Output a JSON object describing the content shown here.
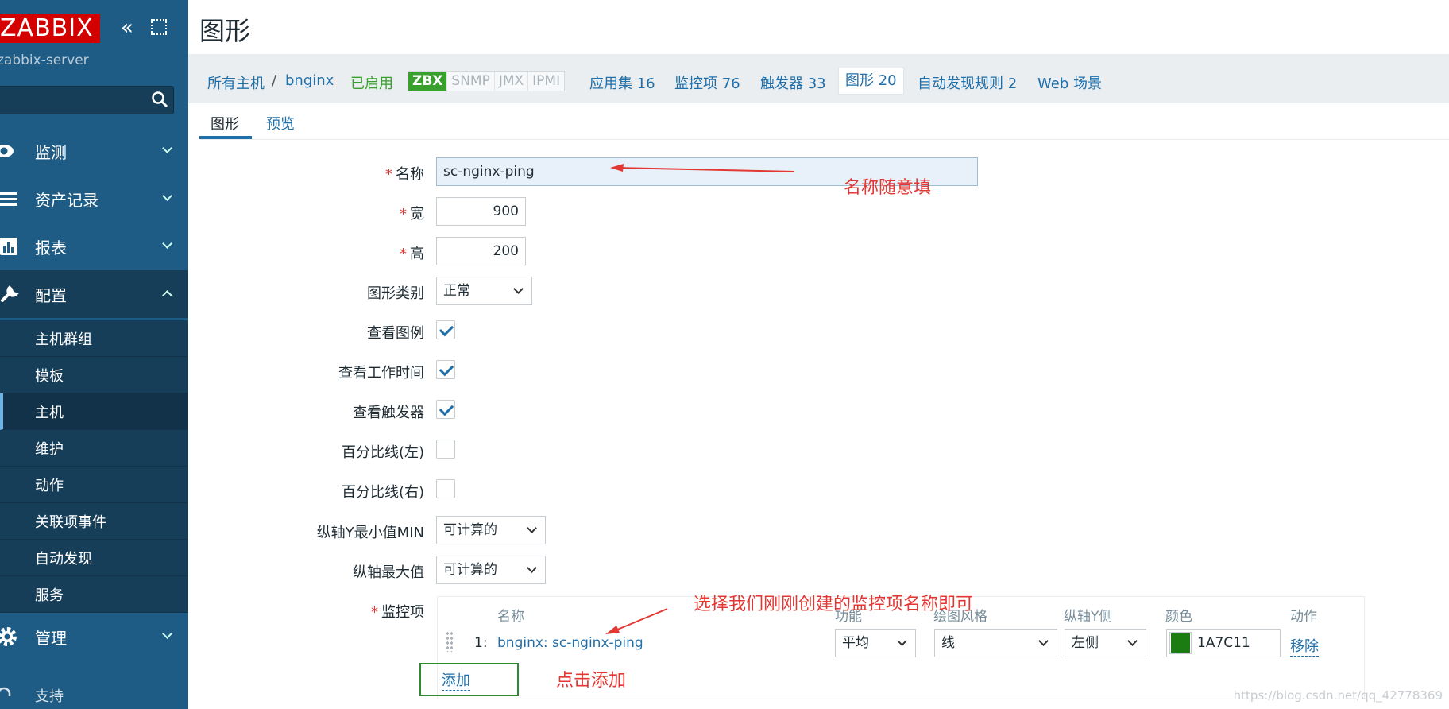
{
  "sidebar": {
    "logo": "ZABBIX",
    "server_name": "zabbix-server",
    "search_placeholder": "",
    "nav": [
      {
        "label": "监测",
        "icon": "eye-icon",
        "expanded": false
      },
      {
        "label": "资产记录",
        "icon": "list-icon",
        "expanded": false
      },
      {
        "label": "报表",
        "icon": "bar-chart-icon",
        "expanded": false
      },
      {
        "label": "配置",
        "icon": "wrench-icon",
        "expanded": true
      },
      {
        "label": "管理",
        "icon": "gear-icon",
        "expanded": false
      }
    ],
    "config_items": [
      "主机群组",
      "模板",
      "主机",
      "维护",
      "动作",
      "关联项事件",
      "自动发现",
      "服务"
    ],
    "current_config_item": "主机",
    "support": "支持"
  },
  "page": {
    "title": "图形"
  },
  "hostbar": {
    "all_hosts": "所有主机",
    "separator": "/",
    "host": "bnginx",
    "status": "已启用",
    "availability": [
      "ZBX",
      "SNMP",
      "JMX",
      "IPMI"
    ],
    "applications": "应用集 16",
    "items": "监控项 76",
    "triggers": "触发器 33",
    "graphs": "图形 20",
    "discovery": "自动发现规则 2",
    "web": "Web 场景"
  },
  "tabs": [
    "图形",
    "预览"
  ],
  "form": {
    "name_label": "名称",
    "name_value": "sc-nginx-ping",
    "width_label": "宽",
    "width_value": "900",
    "height_label": "高",
    "height_value": "200",
    "type_label": "图形类别",
    "type_value": "正常",
    "show_legend_label": "查看图例",
    "show_work_label": "查看工作时间",
    "show_triggers_label": "查看触发器",
    "percent_left_label": "百分比线(左)",
    "percent_right_label": "百分比线(右)",
    "ymin_label": "纵轴Y最小值MIN",
    "ymin_value": "可计算的",
    "ymax_label": "纵轴最大值",
    "ymax_value": "可计算的",
    "items_label": "监控项",
    "checkboxes": {
      "legend": true,
      "work": true,
      "triggers": true,
      "pleft": false,
      "pright": false
    }
  },
  "items_table": {
    "headers": [
      "名称",
      "功能",
      "绘图风格",
      "纵轴Y侧",
      "颜色",
      "动作"
    ],
    "rows": [
      {
        "index": "1:",
        "name": "bnginx: sc-nginx-ping",
        "function": "平均",
        "style": "线",
        "yside": "左侧",
        "color": "1A7C11",
        "swatch": "#1a7c11",
        "action": "移除"
      }
    ],
    "add_label": "添加"
  },
  "annotations": {
    "name_note": "名称随意填",
    "item_note": "选择我们刚刚创建的监控项名称即可",
    "add_note": "点击添加"
  },
  "watermark": "https://blog.csdn.net/qq_42778369"
}
